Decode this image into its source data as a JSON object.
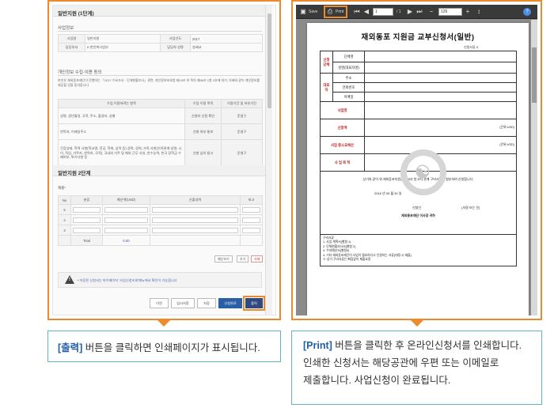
{
  "captions": {
    "left_highlight": "[출력]",
    "left_text": " 버튼을 클릭하면 인쇄페이지가 표시됩니다.",
    "right_highlight": "[Print]",
    "right_text_1": " 버튼을 클릭한 후 온라인신청서를 인쇄합니다.",
    "right_text_2": "인쇄한 신청서는 해당공관에 우편 또는 이메일로",
    "right_text_3": "제출합니다. 사업신청이 완료됩니다."
  },
  "form": {
    "header": "일반지원 (1단계)",
    "business_section": "사업정보",
    "business_rows": [
      {
        "label_1": "사업명",
        "value_1": "일반지원",
        "label_2": "사업년도",
        "value_2": "2017"
      },
      {
        "label_1": "담당부서",
        "value_1": "e-한인축사업부",
        "label_2": "담당자 성명",
        "value_2": "송혜교"
      }
    ],
    "consent_section": "개인정보 수집·이용 동의",
    "consent_paragraph": "본인은 재외동포재단이 진행하는 「2017 수요조사 · 단체현황조사」관련, 개인정보보호법 제15조 보 목의 제58조 1항 2호에 의거, 아래와 같이 개인정보를 제공할 것을 동의합니다",
    "consent_headers": [
      "수집 이용하려는 항목",
      "수집·이용 목적",
      "이용기간 및 보유기간"
    ],
    "consent_rows": [
      {
        "item": "성명, 생년월일, 국적, 주소, 출생지, 성별",
        "purpose": "신청자 신원 확인",
        "period": "준영구"
      },
      {
        "item": "연락처, 이메일주소",
        "purpose": "선발 여부 통보",
        "period": "준영구"
      },
      {
        "item": "건강상태, 학력 사항(학교명, 전공, 학위, 성적 등) 경력, 경력, 가족 사항(가족관계 성명, 나이, 직업, 거주지, 연락처, 국적), 국내외 거주 및 해외 근무 사실, 연수능력, 한국 장학금 수혜여부, 특기사항 등",
        "purpose": "선발 심의 참고",
        "period": "준영구"
      }
    ],
    "stage2_header": "일반지원 2단계",
    "budget_label": "재출*",
    "budget_headers": [
      "No",
      "분류",
      "예산액(USD)",
      "산출내역",
      "비고"
    ],
    "budget_rows": [
      "5",
      "4",
      "3"
    ],
    "total_label": "Total",
    "total_value": "0.00",
    "row_buttons": [
      "예산보기",
      "추가",
      "삭제"
    ],
    "notice_text": "• 저장된 신청서는 마이페이지 '사업신청조회'메뉴에서 확인이 가능합니다",
    "warning_glyph": "!",
    "footer_buttons": {
      "prev": "이전",
      "temp_save": "임시저장",
      "save": "저장",
      "apply": "신청완료",
      "print": "출력"
    }
  },
  "viewer": {
    "toolbar": {
      "save": "Save",
      "print": "Print",
      "page_value": "1",
      "page_total": "/ 1",
      "zoom_value": "126"
    },
    "document": {
      "title": "재외동포 지원금 교부신청서(일반)",
      "form_no": "신청서류 5",
      "rows": {
        "applicant_group": "신청단체",
        "org_name": "단체명",
        "rep_name": "성명(대표자명)",
        "rep_group": "대표자",
        "address": "주소",
        "phone": "전화번호",
        "email": "이메일",
        "business_name": "사업명",
        "application_amount": "신청액",
        "business_period": "사업 총소요예산",
        "business_content": "사 업 목 적"
      },
      "application_units": [
        "(단위:USD)",
        "(단위:USD)"
      ],
      "statement": "상기와 같이 위 재외동포지원금을 교부 받고자 관계 구비서류를 첨부하여 신청합니다.",
      "date_line": "2016 년          05 월          30 일",
      "applicant_label": "신청인",
      "applicant_sign": "(서명 또는 인)",
      "addressee": "재외동포재단 이사장 귀하",
      "attachments": "구비서류\n1. 사업 계획서(별첨 1)\n2. 단체현황조사서(별첨 2)\n3. 수지예산서(별첨3)\n4. 기타 재외동포재단이 사업이 필요하다고 인정하는 서류(대정 시 제출)\n ※ 상기 구비서류는 빠짐없이 제출요망"
    }
  }
}
